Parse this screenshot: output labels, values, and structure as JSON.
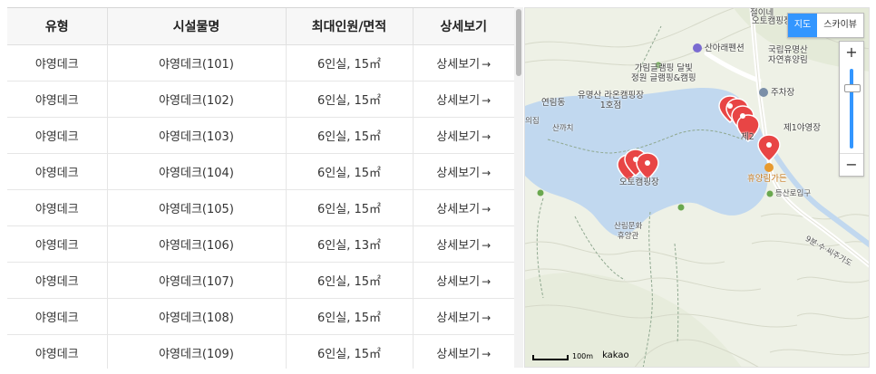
{
  "table": {
    "headers": [
      "유형",
      "시설물명",
      "최대인원/면적",
      "상세보기"
    ],
    "rows": [
      {
        "type": "야영데크",
        "name": "야영데크(101)",
        "capacity": "6인실, 15㎡",
        "detail": "상세보기"
      },
      {
        "type": "야영데크",
        "name": "야영데크(102)",
        "capacity": "6인실, 15㎡",
        "detail": "상세보기"
      },
      {
        "type": "야영데크",
        "name": "야영데크(103)",
        "capacity": "6인실, 15㎡",
        "detail": "상세보기"
      },
      {
        "type": "야영데크",
        "name": "야영데크(104)",
        "capacity": "6인실, 15㎡",
        "detail": "상세보기"
      },
      {
        "type": "야영데크",
        "name": "야영데크(105)",
        "capacity": "6인실, 15㎡",
        "detail": "상세보기"
      },
      {
        "type": "야영데크",
        "name": "야영데크(106)",
        "capacity": "6인실, 13㎡",
        "detail": "상세보기"
      },
      {
        "type": "야영데크",
        "name": "야영데크(107)",
        "capacity": "6인실, 15㎡",
        "detail": "상세보기"
      },
      {
        "type": "야영데크",
        "name": "야영데크(108)",
        "capacity": "6인실, 15㎡",
        "detail": "상세보기"
      },
      {
        "type": "야영데크",
        "name": "야영데크(109)",
        "capacity": "6인실, 15㎡",
        "detail": "상세보기"
      }
    ],
    "arrow_icon": "→"
  },
  "map": {
    "type_buttons": {
      "map": "지도",
      "skyview": "스카이뷰"
    },
    "zoom": {
      "in": "+",
      "out": "−"
    },
    "scale": "100m",
    "logo": "kakao",
    "labels": {
      "jeolline": "절이네",
      "auto_camping_top": "오토캠핑장",
      "sanarae": "산아래펜션",
      "national_forest": "국립유명산\n자연휴양림",
      "galim": "가림글램핑 달빛\n정원 글램핑&캠핑",
      "parking": "주차장",
      "yeonrimdong": "연림동",
      "yumyeongsan_raon": "유명산 라온캠핑장\n1호점",
      "sankkachi": "산까치",
      "ejib": "의집",
      "first_camp": "제1야영장",
      "second_camp": "제2",
      "auto_camping": "오토캠핑장",
      "hyuyangnim_garden": "휴양림가든",
      "trail_entrance": "등산로입구",
      "forest_culture": "산림문화\n휴양관",
      "road_9": "9분·수·씨주가도"
    },
    "colors": {
      "water": "#b9d4ee",
      "road": "#ffffff",
      "marker": "#e84545",
      "accent": "#3396ff"
    }
  }
}
